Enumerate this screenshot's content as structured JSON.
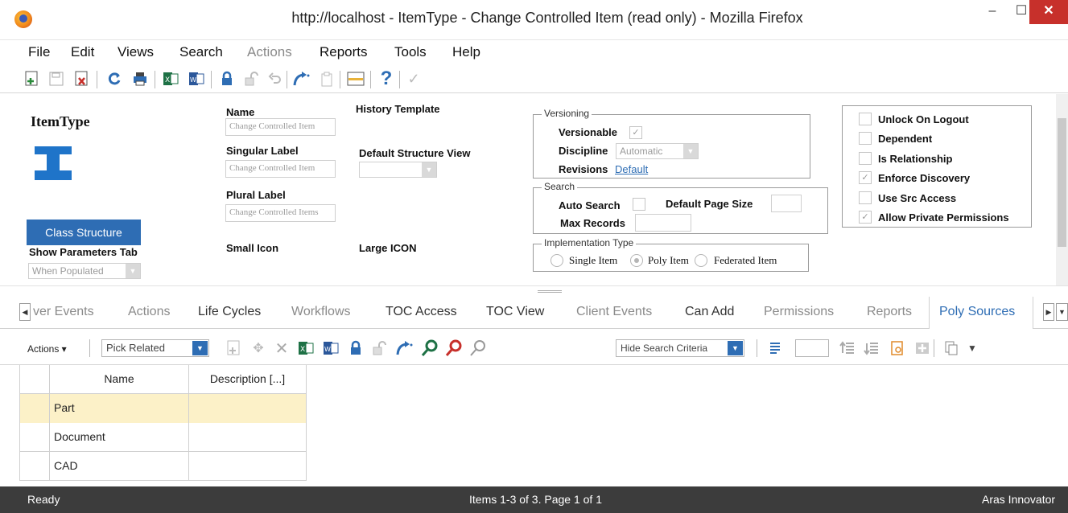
{
  "window": {
    "title": "http://localhost - ItemType - Change Controlled Item (read only) - Mozilla Firefox",
    "minimize": "–",
    "maximize": "☐",
    "close": "✕"
  },
  "menu": [
    "File",
    "Edit",
    "Views",
    "Search",
    "Actions",
    "Reports",
    "Tools",
    "Help"
  ],
  "form": {
    "heading": "ItemType",
    "name_label": "Name",
    "name_value": "Change Controlled Item",
    "history_template_label": "History Template",
    "singular_label": "Singular Label",
    "singular_value": "Change Controlled Item",
    "default_structure_view_label": "Default Structure View",
    "plural_label": "Plural Label",
    "plural_value": "Change Controlled Items",
    "class_structure_button": "Class Structure",
    "small_icon_label": "Small Icon",
    "large_icon_label": "Large ICON",
    "show_parameters_tab_label": "Show Parameters Tab",
    "show_parameters_tab_value": "When Populated",
    "versioning": {
      "legend": "Versioning",
      "versionable_label": "Versionable",
      "versionable_checked": true,
      "discipline_label": "Discipline",
      "discipline_value": "Automatic",
      "revisions_label": "Revisions",
      "revisions_link": "Default"
    },
    "search": {
      "legend": "Search",
      "auto_search_label": "Auto Search",
      "default_page_size_label": "Default Page Size",
      "max_records_label": "Max Records"
    },
    "implementation": {
      "legend": "Implementation Type",
      "options": [
        "Single Item",
        "Poly Item",
        "Federated Item"
      ],
      "selected": "Poly Item"
    },
    "checkboxes": [
      {
        "label": "Unlock On Logout",
        "checked": false
      },
      {
        "label": "Dependent",
        "checked": false
      },
      {
        "label": "Is Relationship",
        "checked": false
      },
      {
        "label": "Enforce Discovery",
        "checked": true
      },
      {
        "label": "Use Src Access",
        "checked": false
      },
      {
        "label": "Allow Private Permissions",
        "checked": true
      }
    ]
  },
  "tabs": [
    {
      "label": "ver Events",
      "state": "inactive"
    },
    {
      "label": "Actions",
      "state": "inactive"
    },
    {
      "label": "Life Cycles",
      "state": "normal"
    },
    {
      "label": "Workflows",
      "state": "inactive"
    },
    {
      "label": "TOC Access",
      "state": "normal"
    },
    {
      "label": "TOC View",
      "state": "normal"
    },
    {
      "label": "Client Events",
      "state": "inactive"
    },
    {
      "label": "Can Add",
      "state": "normal"
    },
    {
      "label": "Permissions",
      "state": "inactive"
    },
    {
      "label": "Reports",
      "state": "inactive"
    },
    {
      "label": "Poly Sources",
      "state": "active"
    }
  ],
  "grid_toolbar": {
    "actions_label": "Actions ▾",
    "pick_related": "Pick Related",
    "hide_search_criteria": "Hide Search Criteria"
  },
  "grid": {
    "columns": [
      "Name",
      "Description [...]"
    ],
    "rows": [
      {
        "name": "Part",
        "description": ""
      },
      {
        "name": "Document",
        "description": ""
      },
      {
        "name": "CAD",
        "description": ""
      }
    ]
  },
  "status": {
    "left": "Ready",
    "center": "Items 1-3 of 3. Page 1 of 1",
    "right": "Aras Innovator"
  },
  "colors": {
    "accent": "#2e6db4",
    "selected_row": "#fcf1c8",
    "status_bg": "#3c3c3c",
    "close_button": "#c7302b"
  }
}
